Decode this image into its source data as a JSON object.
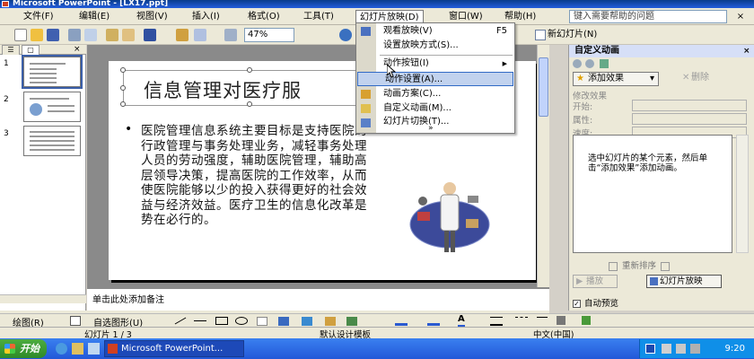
{
  "window": {
    "title": "Microsoft PowerPoint - [LX17.ppt]"
  },
  "menubar": {
    "items": [
      "文件(F)",
      "编辑(E)",
      "视图(V)",
      "插入(I)",
      "格式(O)",
      "工具(T)",
      "幻灯片放映(D)",
      "窗口(W)",
      "帮助(H)"
    ],
    "help_placeholder": "键入需要帮助的问题",
    "close": "×"
  },
  "toolbar": {
    "zoom": "47%",
    "new_slide": "新幻灯片(N)"
  },
  "dropdown": {
    "items": [
      {
        "label": "观看放映(V)",
        "shortcut": "F5",
        "icon": "slideshow-icon"
      },
      {
        "label": "设置放映方式(S)...",
        "shortcut": "",
        "icon": ""
      },
      {
        "label": "动作按钮(I)",
        "shortcut": "▶",
        "icon": ""
      },
      {
        "label": "动作设置(A)...",
        "shortcut": "",
        "icon": ""
      },
      {
        "label": "动画方案(C)...",
        "shortcut": "",
        "icon": "animation-icon"
      },
      {
        "label": "自定义动画(M)...",
        "shortcut": "",
        "icon": "custom-animation-icon"
      },
      {
        "label": "幻灯片切换(T)...",
        "shortcut": "",
        "icon": "transition-icon"
      }
    ],
    "more": "»"
  },
  "left_panel": {
    "tabs": [
      "☰",
      "▢"
    ],
    "close": "×",
    "slide_numbers": [
      "1",
      "2",
      "3"
    ]
  },
  "slide": {
    "title": "信息管理对医疗服",
    "body": "医院管理信息系统主要目标是支持医院的行政管理与事务处理业务，减轻事务处理人员的劳动强度，辅助医院管理，辅助高层领导决策，提高医院的工作效率，从而使医院能够以少的投入获得更好的社会效益与经济效益。医疗卫生的信息化改革是势在必行的。",
    "bullet": "•"
  },
  "notes": {
    "placeholder": "单击此处添加备注"
  },
  "task_pane": {
    "title": "自定义动画",
    "close": "×",
    "add_effect": "添加效果",
    "delete": "删除",
    "modify_label": "修改效果",
    "fields": [
      "开始:",
      "属性:",
      "速度:"
    ],
    "hint": "选中幻灯片的某个元素，然后单击“添加效果”添加动画。",
    "reorder": "重新排序",
    "play": "播放",
    "slideshow": "幻灯片放映",
    "auto_preview": "自动预览"
  },
  "drawing_toolbar": {
    "draw": "绘图(R)",
    "autoshapes": "自选图形(U)"
  },
  "statusbar": {
    "slide_info": "幻灯片 1 / 3",
    "template": "默认设计模板",
    "language": "中文(中国)"
  },
  "taskbar": {
    "start": "开始",
    "app": "Microsoft PowerPoint...",
    "clock": "9:20"
  }
}
